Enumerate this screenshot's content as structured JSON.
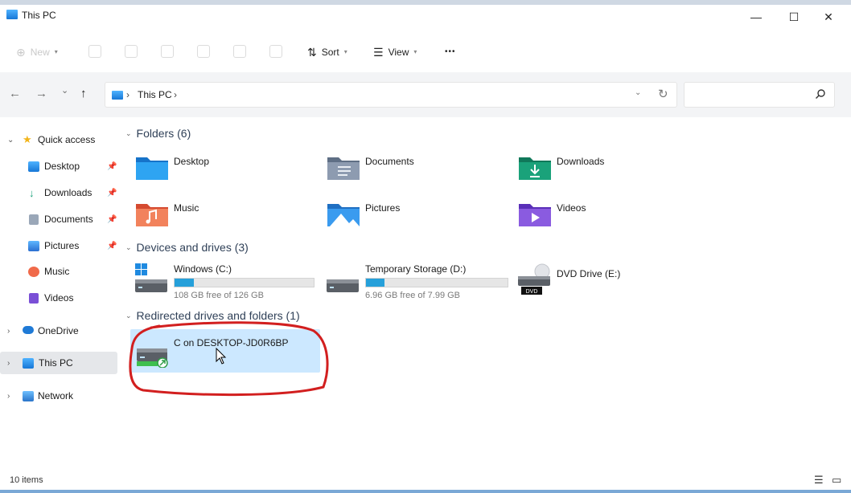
{
  "window": {
    "title": "This PC",
    "minimize": "—",
    "maximize": "☐",
    "close": "✕"
  },
  "toolbar": {
    "new_label": "New",
    "sort_label": "Sort",
    "view_label": "View",
    "more_label": "•••"
  },
  "nav": {
    "back": "←",
    "forward": "→",
    "recent": "⌄",
    "up": "↑",
    "address": "This PC",
    "address_chevron": "›",
    "refresh": "↻",
    "dropdown": "⌄",
    "search_placeholder": ""
  },
  "sidebar": {
    "items": [
      {
        "label": "Quick access",
        "icon": "star-icon"
      },
      {
        "label": "Desktop",
        "icon": "desktop-icon"
      },
      {
        "label": "Downloads",
        "icon": "download-icon"
      },
      {
        "label": "Documents",
        "icon": "documents-icon"
      },
      {
        "label": "Pictures",
        "icon": "pictures-icon"
      },
      {
        "label": "Music",
        "icon": "music-icon"
      },
      {
        "label": "Videos",
        "icon": "videos-icon"
      },
      {
        "label": "OneDrive",
        "icon": "cloud-icon"
      },
      {
        "label": "This PC",
        "icon": "computer-icon"
      },
      {
        "label": "Network",
        "icon": "network-icon"
      }
    ]
  },
  "groups": {
    "folders": {
      "label": "Folders (6)"
    },
    "devices": {
      "label": "Devices and drives (3)"
    },
    "redirected": {
      "label": "Redirected drives and folders (1)"
    }
  },
  "folders": [
    {
      "name": "Desktop",
      "color": "#1e90e0"
    },
    {
      "name": "Documents",
      "color": "#8494a8"
    },
    {
      "name": "Downloads",
      "color": "#1aa27a"
    },
    {
      "name": "Music",
      "color": "#f06a4a"
    },
    {
      "name": "Pictures",
      "color": "#2b8fe3"
    },
    {
      "name": "Videos",
      "color": "#7a4fd6"
    }
  ],
  "drives": [
    {
      "name": "Windows (C:)",
      "free": "108 GB free of 126 GB",
      "used_fraction": 0.14
    },
    {
      "name": "Temporary Storage (D:)",
      "free": "6.96 GB free of 7.99 GB",
      "used_fraction": 0.13
    },
    {
      "name": "DVD Drive (E:)",
      "badge": "DVD"
    }
  ],
  "redirected": [
    {
      "name": "C on DESKTOP-JD0R6BP"
    }
  ],
  "status": {
    "items": "10 items"
  },
  "colors": {
    "accent": "#26a0da",
    "selection": "#cce8ff",
    "annotation": "#d21f1f"
  }
}
